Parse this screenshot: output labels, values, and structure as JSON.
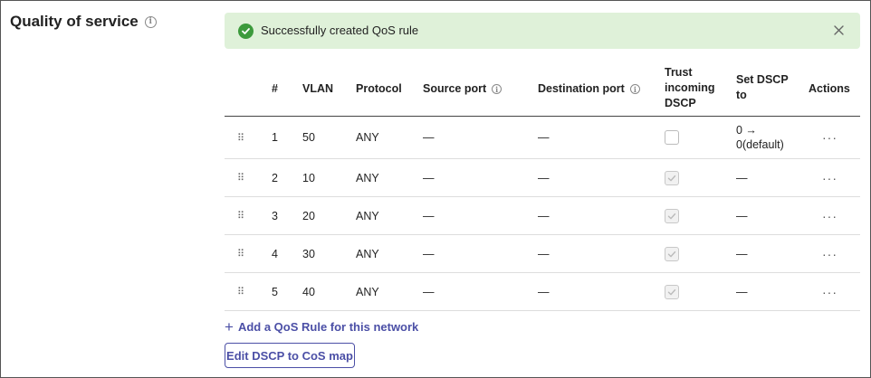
{
  "section": {
    "title": "Quality of service"
  },
  "toast": {
    "message": "Successfully created QoS rule",
    "color": "#dff1d9",
    "icon": "check-circle-icon"
  },
  "table": {
    "headers": {
      "num": "#",
      "vlan": "VLAN",
      "protocol": "Protocol",
      "source_port": "Source port",
      "destination_port": "Destination port",
      "trust_line1": "Trust",
      "trust_line2": "incoming",
      "trust_line3": "DSCP",
      "set_dscp_line1": "Set DSCP",
      "set_dscp_line2": "to",
      "actions": "Actions"
    },
    "rows": [
      {
        "num": "1",
        "vlan": "50",
        "protocol": "ANY",
        "source_port": "—",
        "destination_port": "—",
        "trust": false,
        "set_dscp_line1": "0 →",
        "set_dscp_line2": "0(default)",
        "actions": "···"
      },
      {
        "num": "2",
        "vlan": "10",
        "protocol": "ANY",
        "source_port": "—",
        "destination_port": "—",
        "trust": true,
        "set_dscp": "—",
        "actions": "···"
      },
      {
        "num": "3",
        "vlan": "20",
        "protocol": "ANY",
        "source_port": "—",
        "destination_port": "—",
        "trust": true,
        "set_dscp": "—",
        "actions": "···"
      },
      {
        "num": "4",
        "vlan": "30",
        "protocol": "ANY",
        "source_port": "—",
        "destination_port": "—",
        "trust": true,
        "set_dscp": "—",
        "actions": "···"
      },
      {
        "num": "5",
        "vlan": "40",
        "protocol": "ANY",
        "source_port": "—",
        "destination_port": "—",
        "trust": true,
        "set_dscp": "—",
        "actions": "···"
      }
    ]
  },
  "add_rule": {
    "label": "Add a QoS Rule for this network"
  },
  "edit_map": {
    "label": "Edit DSCP to CoS map"
  },
  "colors": {
    "accent": "#4b4fa6",
    "success": "#3c9a3c"
  }
}
